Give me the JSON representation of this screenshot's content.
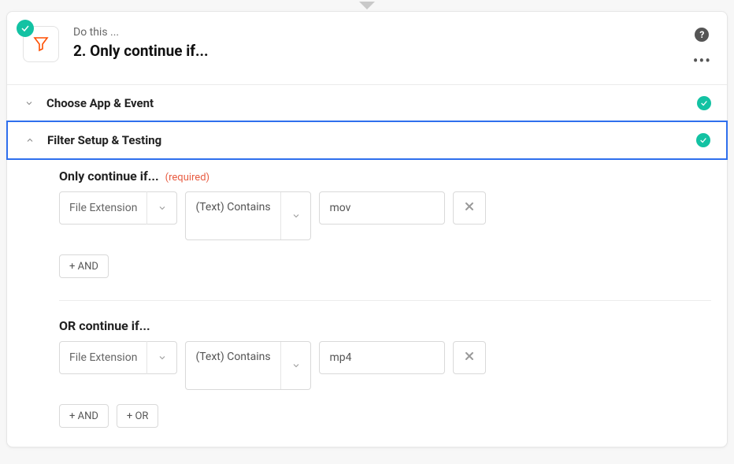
{
  "header": {
    "do_this": "Do this ...",
    "title": "2. Only continue if..."
  },
  "sections": {
    "choose": {
      "title": "Choose App & Event"
    },
    "filter": {
      "title": "Filter Setup & Testing"
    }
  },
  "filter": {
    "group1": {
      "label": "Only continue if...",
      "required": "(required)",
      "field": "File Extension",
      "op": "(Text) Contains",
      "value": "mov",
      "and_btn": "+ AND"
    },
    "group2": {
      "label": "OR continue if...",
      "field": "File Extension",
      "op": "(Text) Contains",
      "value": "mp4",
      "and_btn": "+ AND",
      "or_btn": "+ OR"
    }
  }
}
